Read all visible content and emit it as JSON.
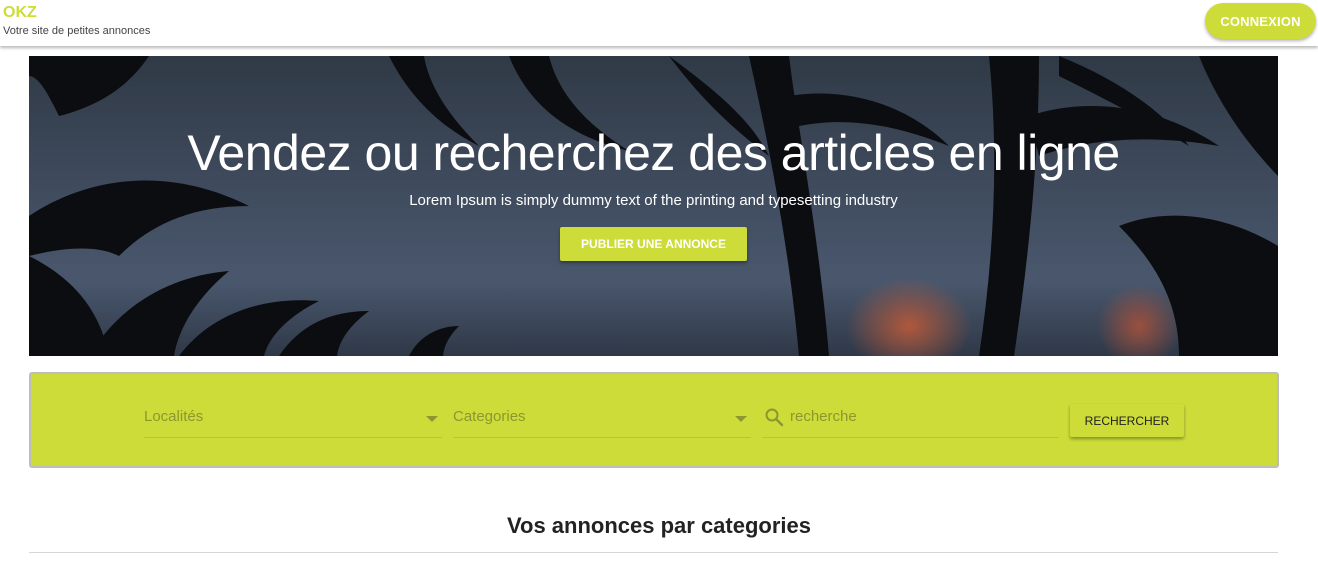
{
  "header": {
    "brand_name": "OKZ",
    "tagline": "Votre site de petites annonces",
    "login_label": "CONNEXION"
  },
  "hero": {
    "title": "Vendez ou recherchez des articles en ligne",
    "subtitle": "Lorem Ipsum is simply dummy text of the printing and typesetting industry",
    "publish_label": "PUBLIER UNE ANNONCE"
  },
  "search": {
    "location_placeholder": "Localités",
    "category_placeholder": "Categories",
    "query_placeholder": "recherche",
    "submit_label": "RECHERCHER"
  },
  "section": {
    "title": "Vos annonces par categories"
  },
  "colors": {
    "accent": "#cddc39",
    "text": "#222222"
  },
  "icons": {
    "search": "search-icon",
    "dropdown": "caret-down-icon"
  }
}
